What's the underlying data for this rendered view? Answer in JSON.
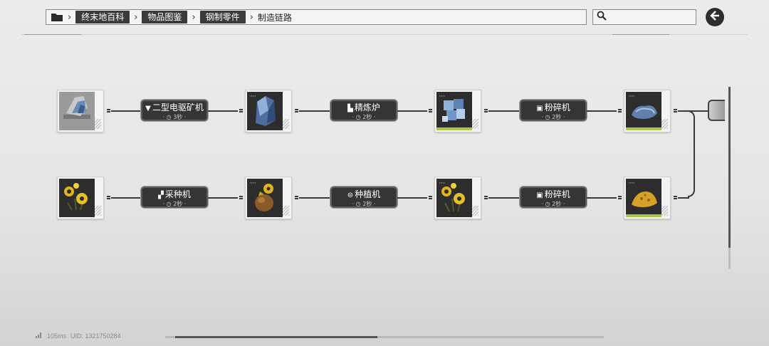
{
  "breadcrumb": {
    "items": [
      "终末地百科",
      "物品图鉴",
      "钢制零件"
    ],
    "current": "制造链路"
  },
  "search": {
    "placeholder": ""
  },
  "chains": [
    {
      "items": [
        "blue-ore-grey",
        "blue-crystal",
        "blue-cube-cluster",
        "blue-powder"
      ],
      "machines": [
        {
          "name": "二型电驱矿机",
          "time": "3秒",
          "icon": "drill-icon"
        },
        {
          "name": "精炼炉",
          "time": "2秒",
          "icon": "furnace-icon"
        },
        {
          "name": "粉碎机",
          "time": "2秒",
          "icon": "crusher-icon"
        }
      ]
    },
    {
      "items": [
        "yellow-flower",
        "yellow-seed-pod",
        "yellow-flower",
        "yellow-powder"
      ],
      "machines": [
        {
          "name": "采种机",
          "time": "2秒",
          "icon": "seed-picker-icon"
        },
        {
          "name": "种植机",
          "time": "2秒",
          "icon": "planter-icon"
        },
        {
          "name": "粉碎机",
          "time": "2秒",
          "icon": "crusher-icon"
        }
      ]
    }
  ],
  "status": {
    "ping": "105ms",
    "uid": "UID: 1321750284"
  },
  "colors": {
    "accent_green": "#a6c64a",
    "node_bg": "#353535",
    "crumb_bg": "#3b3b3b"
  }
}
